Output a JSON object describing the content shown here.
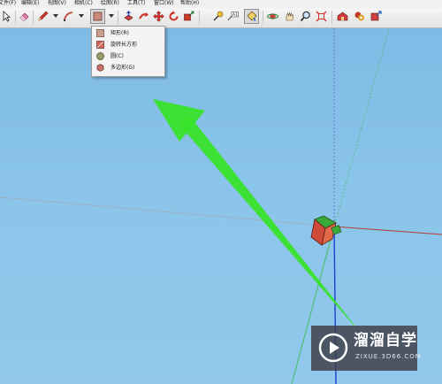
{
  "menu": [
    {
      "label": "文件(F)"
    },
    {
      "label": "编辑(E)"
    },
    {
      "label": "视图(V)"
    },
    {
      "label": "相机(C)"
    },
    {
      "label": "绘图(R)"
    },
    {
      "label": "工具(T)"
    },
    {
      "label": "窗口(W)"
    },
    {
      "label": "帮助(H)"
    }
  ],
  "toolbar": {
    "icons": [
      "select-arrow-icon",
      "eraser-icon",
      "pencil-icon",
      "arc-icon",
      "rectangle-icon",
      "push-pull-icon",
      "follow-me-icon",
      "move-icon",
      "rotate-icon",
      "scale-icon",
      "tape-measure-icon",
      "text-icon",
      "paint-bucket-icon",
      "orbit-icon",
      "pan-icon",
      "zoom-icon",
      "zoom-extents-icon",
      "warehouse-icon",
      "components-icon",
      "share-icon"
    ],
    "active_tool": "rectangle-icon"
  },
  "shape_dropdown": {
    "items": [
      {
        "label": "矩形(R)",
        "icon": "rectangle-icon"
      },
      {
        "label": "旋转长方形",
        "icon": "rotated-rectangle-icon"
      },
      {
        "label": "圆(C)",
        "icon": "circle-icon"
      },
      {
        "label": "多边形(G)",
        "icon": "polygon-icon"
      }
    ]
  },
  "watermark": {
    "title": "溜溜自学",
    "subtitle": "ZIXUE.3D66.COM"
  },
  "colors": {
    "sky": "#86c0e6",
    "annotation_arrow": "#39e22b",
    "axis_red": "#b53a3a",
    "axis_green": "#3fbf5a",
    "axis_blue": "#1e3fd0"
  }
}
